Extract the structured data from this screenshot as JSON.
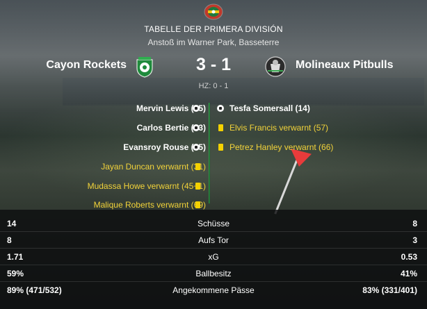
{
  "header": {
    "competition_title": "TABELLE DER PRIMERA DIVISIÓN",
    "venue_line": "Anstoß im Warner Park, Basseterre"
  },
  "match": {
    "home_team": "Cayon Rockets",
    "away_team": "Molineaux Pitbulls",
    "score": "3 - 1",
    "halftime": "HZ: 0 - 1"
  },
  "events": {
    "home": [
      {
        "text": "Mervin Lewis (55)",
        "type": "goal"
      },
      {
        "text": "Carlos Bertie (63)",
        "type": "goal"
      },
      {
        "text": "Evansroy Rouse (85)",
        "type": "goal"
      },
      {
        "text": "Jayan Duncan verwarnt (31)",
        "type": "yellow-card"
      },
      {
        "text": "Mudassa Howe verwarnt (45+1)",
        "type": "yellow-card"
      },
      {
        "text": "Malique Roberts verwarnt (69)",
        "type": "yellow-card"
      }
    ],
    "away": [
      {
        "text": "Tesfa Somersall (14)",
        "type": "goal"
      },
      {
        "text": "Elvis Francis verwarnt (57)",
        "type": "yellow-card"
      },
      {
        "text": "Petrez Hanley verwarnt (66)",
        "type": "yellow-card"
      }
    ]
  },
  "stats": [
    {
      "label": "Schüsse",
      "home": "14",
      "away": "8"
    },
    {
      "label": "Aufs Tor",
      "home": "8",
      "away": "3"
    },
    {
      "label": "xG",
      "home": "1.71",
      "away": "0.53"
    },
    {
      "label": "Ballbesitz",
      "home": "59%",
      "away": "41%"
    },
    {
      "label": "Angekommene Pässe",
      "home": "89% (471/532)",
      "away": "83% (331/401)"
    }
  ],
  "colors": {
    "accent_green": "#3aa851",
    "card_yellow": "#f4d100",
    "card_text": "#f2d33a"
  },
  "icons": {
    "competition": "competition-logo-icon",
    "home_crest": "cayon-rockets-crest-icon",
    "away_crest": "molineaux-pitbulls-crest-icon",
    "goal": "football-icon",
    "card": "yellow-card-icon"
  }
}
